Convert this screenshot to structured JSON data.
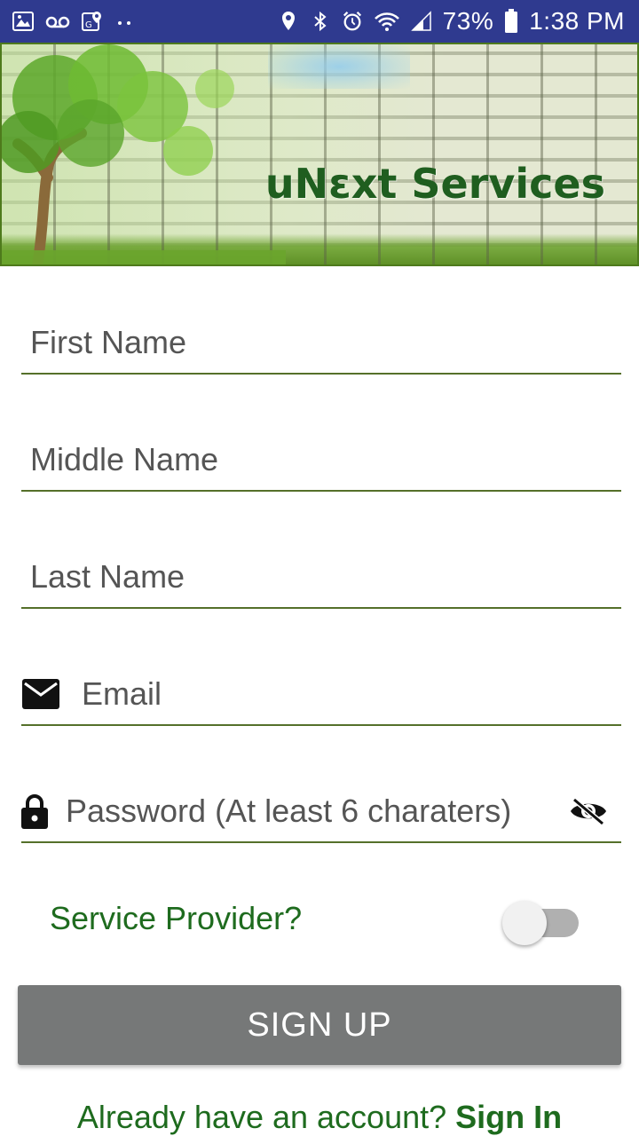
{
  "status_bar": {
    "battery": "73%",
    "time": "1:38 PM",
    "left_icons": [
      "image-icon",
      "voicemail-icon",
      "maps-icon",
      "more-dots-icon"
    ],
    "right_icons": [
      "location-icon",
      "bluetooth-icon",
      "alarm-icon",
      "wifi-icon",
      "signal-icon",
      "battery-icon"
    ],
    "background": "#2f3a8f"
  },
  "banner": {
    "title": "uNεxt Services",
    "title_color": "#1f5e1f"
  },
  "form": {
    "first_name_placeholder": "First Name",
    "middle_name_placeholder": "Middle Name",
    "last_name_placeholder": "Last Name",
    "email_placeholder": "Email",
    "password_placeholder": "Password (At least 6 charaters)",
    "email_icon": "mail-icon",
    "password_icon": "lock-icon",
    "password_toggle_icon": "eye-off-icon",
    "underline_color": "#55702a"
  },
  "service_provider": {
    "label": "Service Provider?",
    "checked": false,
    "label_color": "#1e6b1e"
  },
  "signup": {
    "label": "SIGN UP",
    "background": "#767878"
  },
  "footer": {
    "prompt": "Already have an account? ",
    "link": "Sign In",
    "color": "#1e6b1e"
  }
}
